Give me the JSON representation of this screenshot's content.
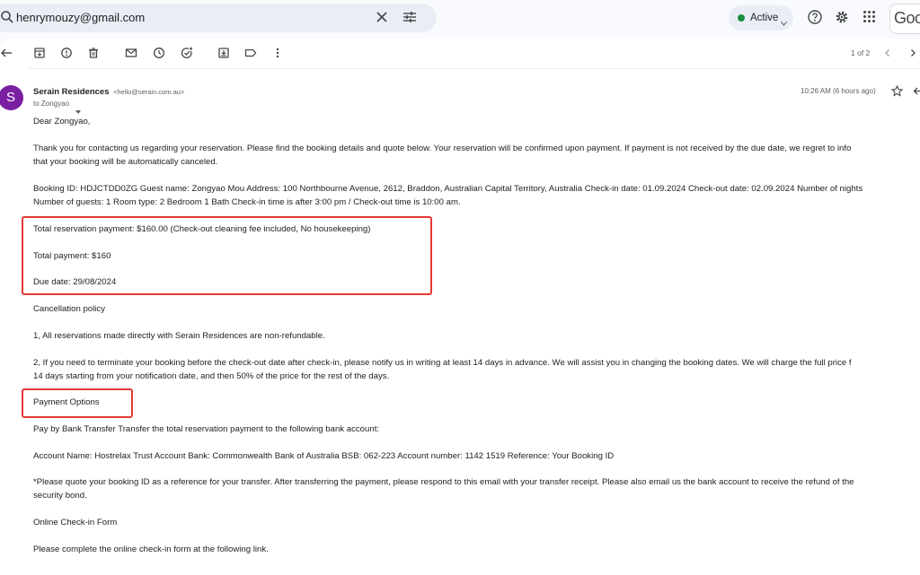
{
  "search": {
    "value": "henrymouzy@gmail.com"
  },
  "status": {
    "label": "Active",
    "color": "#1e8e3e"
  },
  "brand": {
    "logo_text": "Goo"
  },
  "toolbar": {
    "pager": "1 of 2"
  },
  "email": {
    "sender_name": "Serain Residences",
    "sender_email": "<hello@serain.com.au>",
    "to": "to Zongyao",
    "time": "10:26 AM (6 hours ago)",
    "avatar_letter": "S",
    "avatar_color": "#7b1fa2",
    "body": {
      "greeting": "Dear Zongyao,",
      "intro_1": "Thank you for contacting us regarding your reservation. Please find the booking details and quote below. Your reservation will be confirmed upon payment. If payment is not received by the due date, we regret to info",
      "intro_2": "that your booking will be automatically canceled.",
      "booking_1": "Booking ID: HDJCTDD0ZG Guest name: Zongyao Mou Address: 100 Northbourne Avenue, 2612, Braddon, Australian Capital Territory, Australia Check-in date: 01.09.2024 Check-out date: 02.09.2024 Number of nights",
      "booking_2": "Number of guests: 1 Room type: 2 Bedroom 1 Bath Check-in time is after 3:00 pm / Check-out time is 10:00 am.",
      "total_reservation": "Total reservation payment: $160.00 (Check-out cleaning fee included, No housekeeping)",
      "total_payment": "Total payment: $160",
      "due_date": "Due date: 29/08/2024",
      "cancellation_title": "Cancellation policy",
      "cancel_1": "1, All reservations made directly with Serain Residences are non-refundable.",
      "cancel_2a": "2, If you need to terminate your booking before the check-out date after check-in, please notify us in writing at least 14 days in advance. We will assist you in changing the booking dates. We will charge the full price f",
      "cancel_2b": "14 days starting from your notification date, and then 50% of the price for the rest of the days.",
      "payment_options": "Payment Options",
      "pay_by_bank": "Pay by Bank Transfer Transfer the total reservation payment to the following bank account:",
      "account": "Account Name: Hostrelax Trust Account Bank: Commonwealth Bank of Australia BSB: 062-223 Account number: 1142 1519 Reference: Your Booking ID",
      "quote_1": "*Please quote your booking ID as a reference for your transfer. After transferring the payment, please respond to this email with your transfer receipt. Please also email us the bank account to receive the refund of the",
      "quote_2": "security bond.",
      "checkin_title": "Online Check-in Form",
      "checkin_text": "Please complete the online check-in form at the following link."
    }
  },
  "highlight_color": "#e53935"
}
